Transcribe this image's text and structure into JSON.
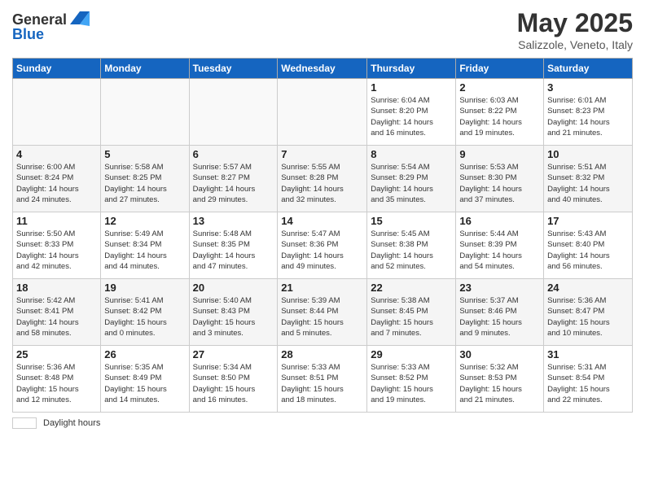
{
  "header": {
    "logo_general": "General",
    "logo_blue": "Blue",
    "title": "May 2025",
    "subtitle": "Salizzole, Veneto, Italy"
  },
  "days_of_week": [
    "Sunday",
    "Monday",
    "Tuesday",
    "Wednesday",
    "Thursday",
    "Friday",
    "Saturday"
  ],
  "weeks": [
    [
      {
        "day": "",
        "info": ""
      },
      {
        "day": "",
        "info": ""
      },
      {
        "day": "",
        "info": ""
      },
      {
        "day": "",
        "info": ""
      },
      {
        "day": "1",
        "info": "Sunrise: 6:04 AM\nSunset: 8:20 PM\nDaylight: 14 hours\nand 16 minutes."
      },
      {
        "day": "2",
        "info": "Sunrise: 6:03 AM\nSunset: 8:22 PM\nDaylight: 14 hours\nand 19 minutes."
      },
      {
        "day": "3",
        "info": "Sunrise: 6:01 AM\nSunset: 8:23 PM\nDaylight: 14 hours\nand 21 minutes."
      }
    ],
    [
      {
        "day": "4",
        "info": "Sunrise: 6:00 AM\nSunset: 8:24 PM\nDaylight: 14 hours\nand 24 minutes."
      },
      {
        "day": "5",
        "info": "Sunrise: 5:58 AM\nSunset: 8:25 PM\nDaylight: 14 hours\nand 27 minutes."
      },
      {
        "day": "6",
        "info": "Sunrise: 5:57 AM\nSunset: 8:27 PM\nDaylight: 14 hours\nand 29 minutes."
      },
      {
        "day": "7",
        "info": "Sunrise: 5:55 AM\nSunset: 8:28 PM\nDaylight: 14 hours\nand 32 minutes."
      },
      {
        "day": "8",
        "info": "Sunrise: 5:54 AM\nSunset: 8:29 PM\nDaylight: 14 hours\nand 35 minutes."
      },
      {
        "day": "9",
        "info": "Sunrise: 5:53 AM\nSunset: 8:30 PM\nDaylight: 14 hours\nand 37 minutes."
      },
      {
        "day": "10",
        "info": "Sunrise: 5:51 AM\nSunset: 8:32 PM\nDaylight: 14 hours\nand 40 minutes."
      }
    ],
    [
      {
        "day": "11",
        "info": "Sunrise: 5:50 AM\nSunset: 8:33 PM\nDaylight: 14 hours\nand 42 minutes."
      },
      {
        "day": "12",
        "info": "Sunrise: 5:49 AM\nSunset: 8:34 PM\nDaylight: 14 hours\nand 44 minutes."
      },
      {
        "day": "13",
        "info": "Sunrise: 5:48 AM\nSunset: 8:35 PM\nDaylight: 14 hours\nand 47 minutes."
      },
      {
        "day": "14",
        "info": "Sunrise: 5:47 AM\nSunset: 8:36 PM\nDaylight: 14 hours\nand 49 minutes."
      },
      {
        "day": "15",
        "info": "Sunrise: 5:45 AM\nSunset: 8:38 PM\nDaylight: 14 hours\nand 52 minutes."
      },
      {
        "day": "16",
        "info": "Sunrise: 5:44 AM\nSunset: 8:39 PM\nDaylight: 14 hours\nand 54 minutes."
      },
      {
        "day": "17",
        "info": "Sunrise: 5:43 AM\nSunset: 8:40 PM\nDaylight: 14 hours\nand 56 minutes."
      }
    ],
    [
      {
        "day": "18",
        "info": "Sunrise: 5:42 AM\nSunset: 8:41 PM\nDaylight: 14 hours\nand 58 minutes."
      },
      {
        "day": "19",
        "info": "Sunrise: 5:41 AM\nSunset: 8:42 PM\nDaylight: 15 hours\nand 0 minutes."
      },
      {
        "day": "20",
        "info": "Sunrise: 5:40 AM\nSunset: 8:43 PM\nDaylight: 15 hours\nand 3 minutes."
      },
      {
        "day": "21",
        "info": "Sunrise: 5:39 AM\nSunset: 8:44 PM\nDaylight: 15 hours\nand 5 minutes."
      },
      {
        "day": "22",
        "info": "Sunrise: 5:38 AM\nSunset: 8:45 PM\nDaylight: 15 hours\nand 7 minutes."
      },
      {
        "day": "23",
        "info": "Sunrise: 5:37 AM\nSunset: 8:46 PM\nDaylight: 15 hours\nand 9 minutes."
      },
      {
        "day": "24",
        "info": "Sunrise: 5:36 AM\nSunset: 8:47 PM\nDaylight: 15 hours\nand 10 minutes."
      }
    ],
    [
      {
        "day": "25",
        "info": "Sunrise: 5:36 AM\nSunset: 8:48 PM\nDaylight: 15 hours\nand 12 minutes."
      },
      {
        "day": "26",
        "info": "Sunrise: 5:35 AM\nSunset: 8:49 PM\nDaylight: 15 hours\nand 14 minutes."
      },
      {
        "day": "27",
        "info": "Sunrise: 5:34 AM\nSunset: 8:50 PM\nDaylight: 15 hours\nand 16 minutes."
      },
      {
        "day": "28",
        "info": "Sunrise: 5:33 AM\nSunset: 8:51 PM\nDaylight: 15 hours\nand 18 minutes."
      },
      {
        "day": "29",
        "info": "Sunrise: 5:33 AM\nSunset: 8:52 PM\nDaylight: 15 hours\nand 19 minutes."
      },
      {
        "day": "30",
        "info": "Sunrise: 5:32 AM\nSunset: 8:53 PM\nDaylight: 15 hours\nand 21 minutes."
      },
      {
        "day": "31",
        "info": "Sunrise: 5:31 AM\nSunset: 8:54 PM\nDaylight: 15 hours\nand 22 minutes."
      }
    ]
  ],
  "footer": {
    "daylight_label": "Daylight hours"
  }
}
